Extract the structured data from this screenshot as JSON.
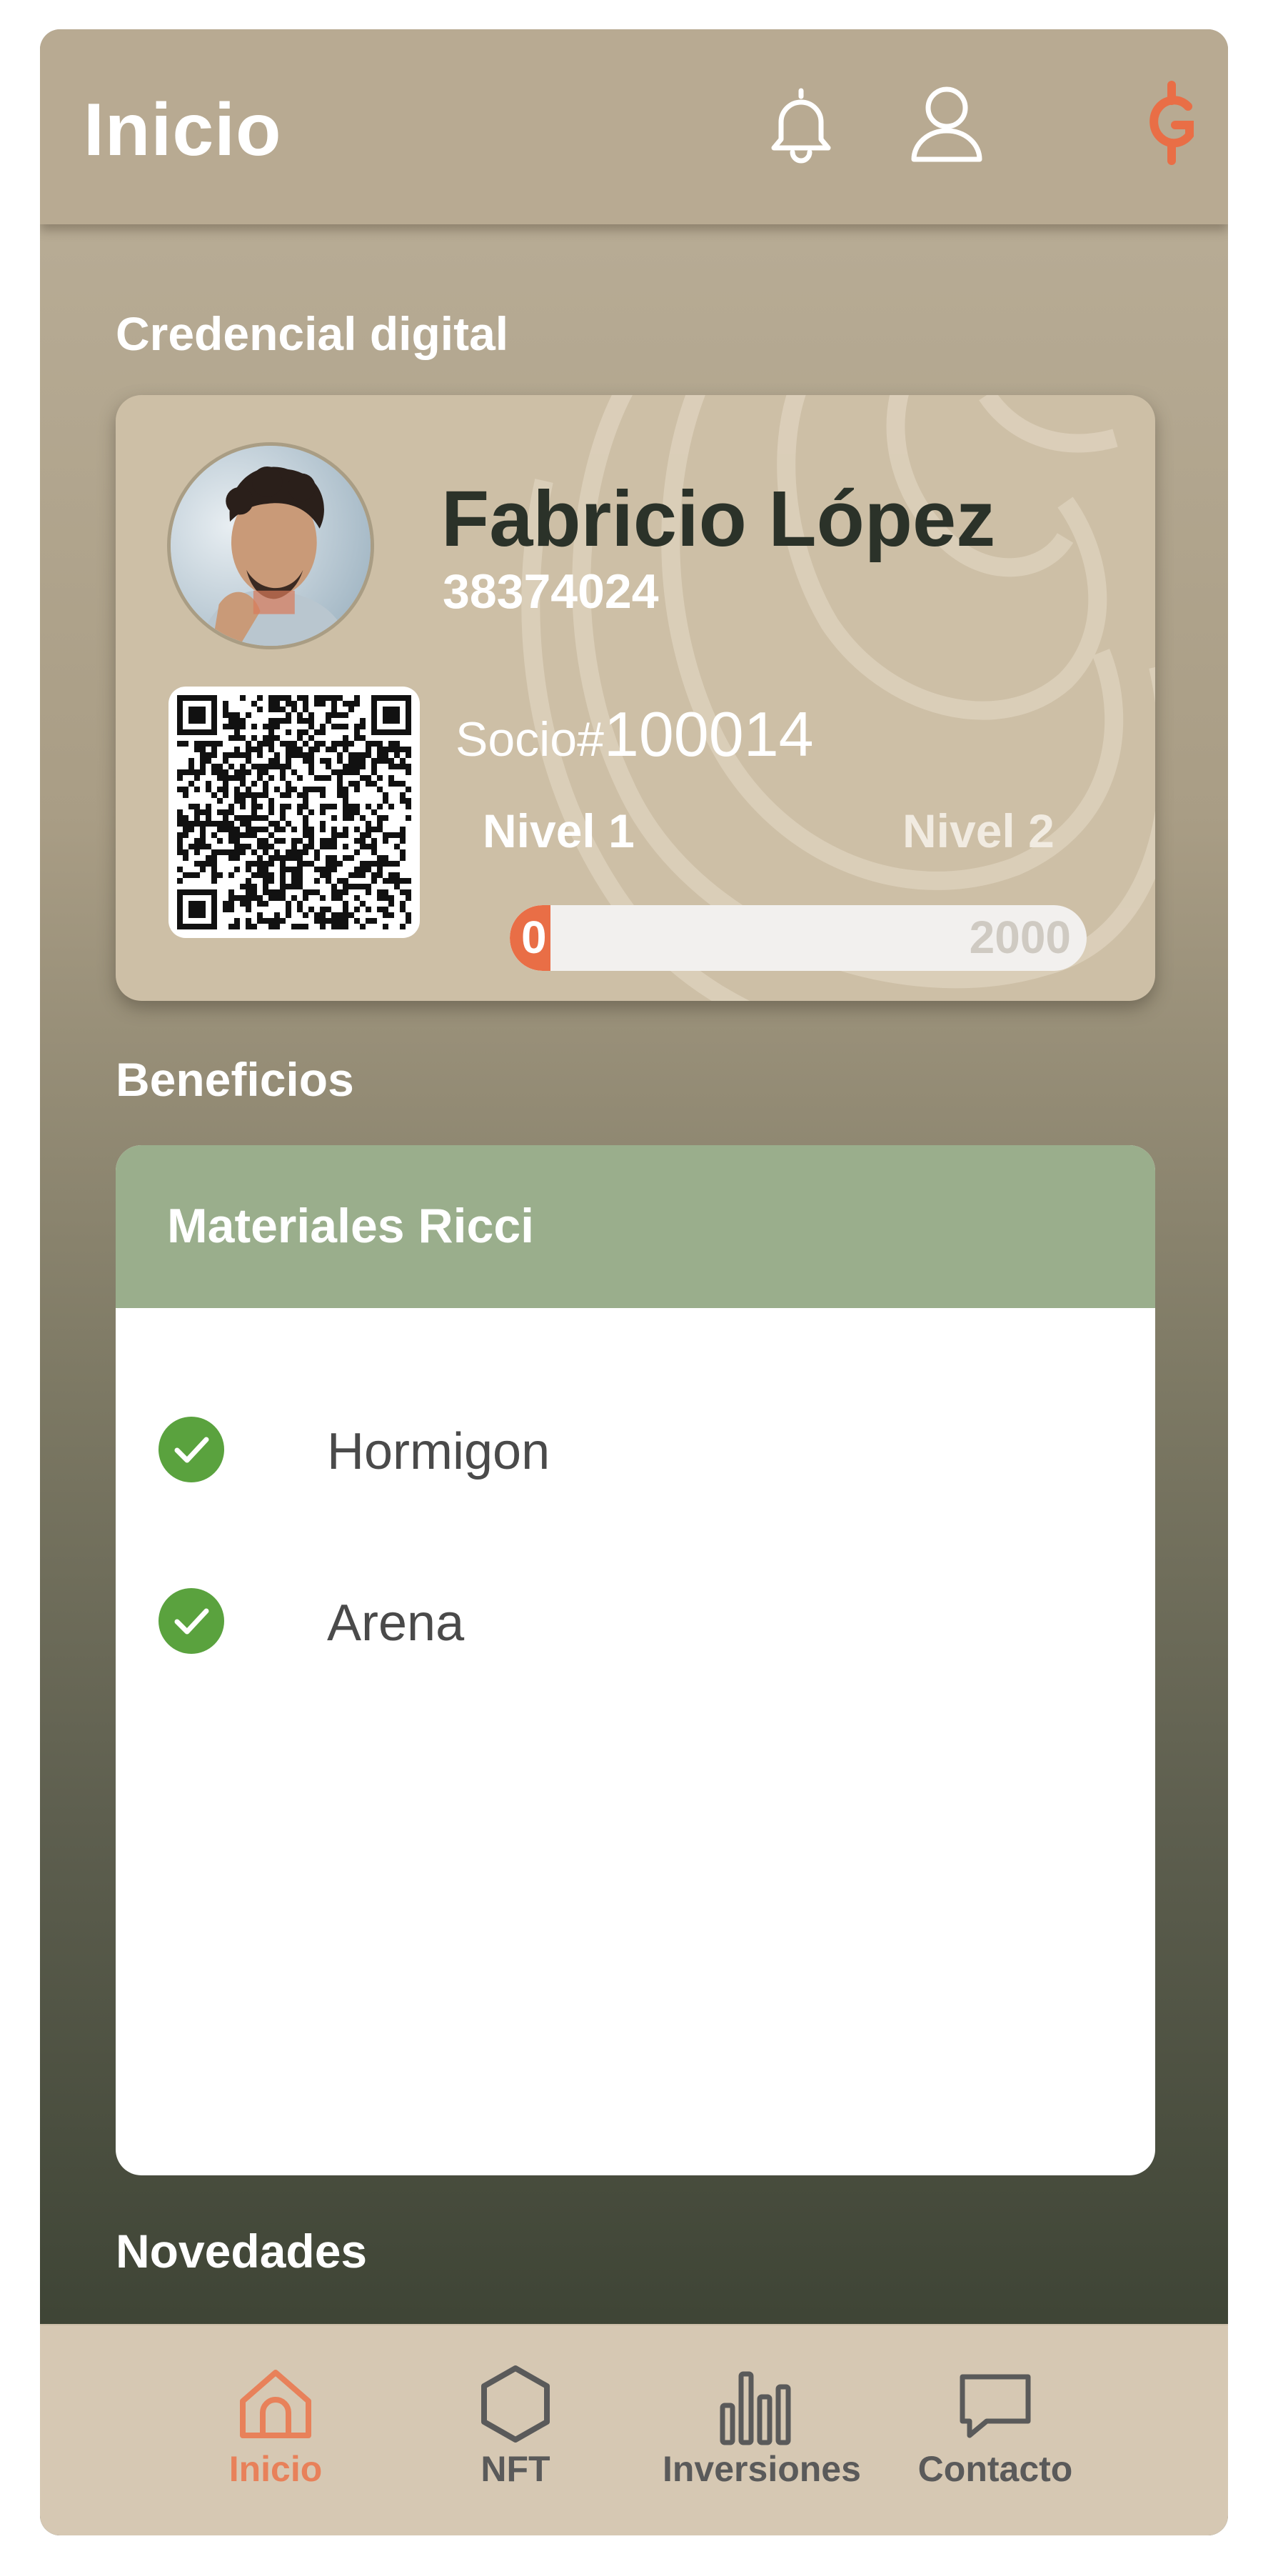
{
  "header": {
    "title": "Inicio",
    "icons": [
      "bell-icon",
      "user-icon",
      "coin-icon"
    ],
    "accent_color": "#e96e46"
  },
  "credential": {
    "section_title": "Credencial digital",
    "name": "Fabricio López",
    "id_number": "38374024",
    "socio_label": "Socio#",
    "socio_number": "100014",
    "level_current": "Nivel 1",
    "level_next": "Nivel 2",
    "progress_value": "0",
    "progress_max": "2000",
    "progress_fraction": 0.07
  },
  "benefits": {
    "section_title": "Beneficios",
    "provider": "Materiales Ricci",
    "items": [
      {
        "label": "Hormigon",
        "icon": "check-circle-icon"
      },
      {
        "label": "Arena",
        "icon": "check-circle-icon"
      }
    ],
    "header_color": "#9aae8c",
    "check_color": "#5aa23e"
  },
  "news": {
    "section_title": "Novedades"
  },
  "bottom_nav": {
    "items": [
      {
        "label": "Inicio",
        "icon": "home-icon",
        "active": true
      },
      {
        "label": "NFT",
        "icon": "hexagon-icon",
        "active": false
      },
      {
        "label": "Inversiones",
        "icon": "bar-chart-icon",
        "active": false
      },
      {
        "label": "Contacto",
        "icon": "chat-icon",
        "active": false
      }
    ],
    "active_color": "#e8815a"
  }
}
